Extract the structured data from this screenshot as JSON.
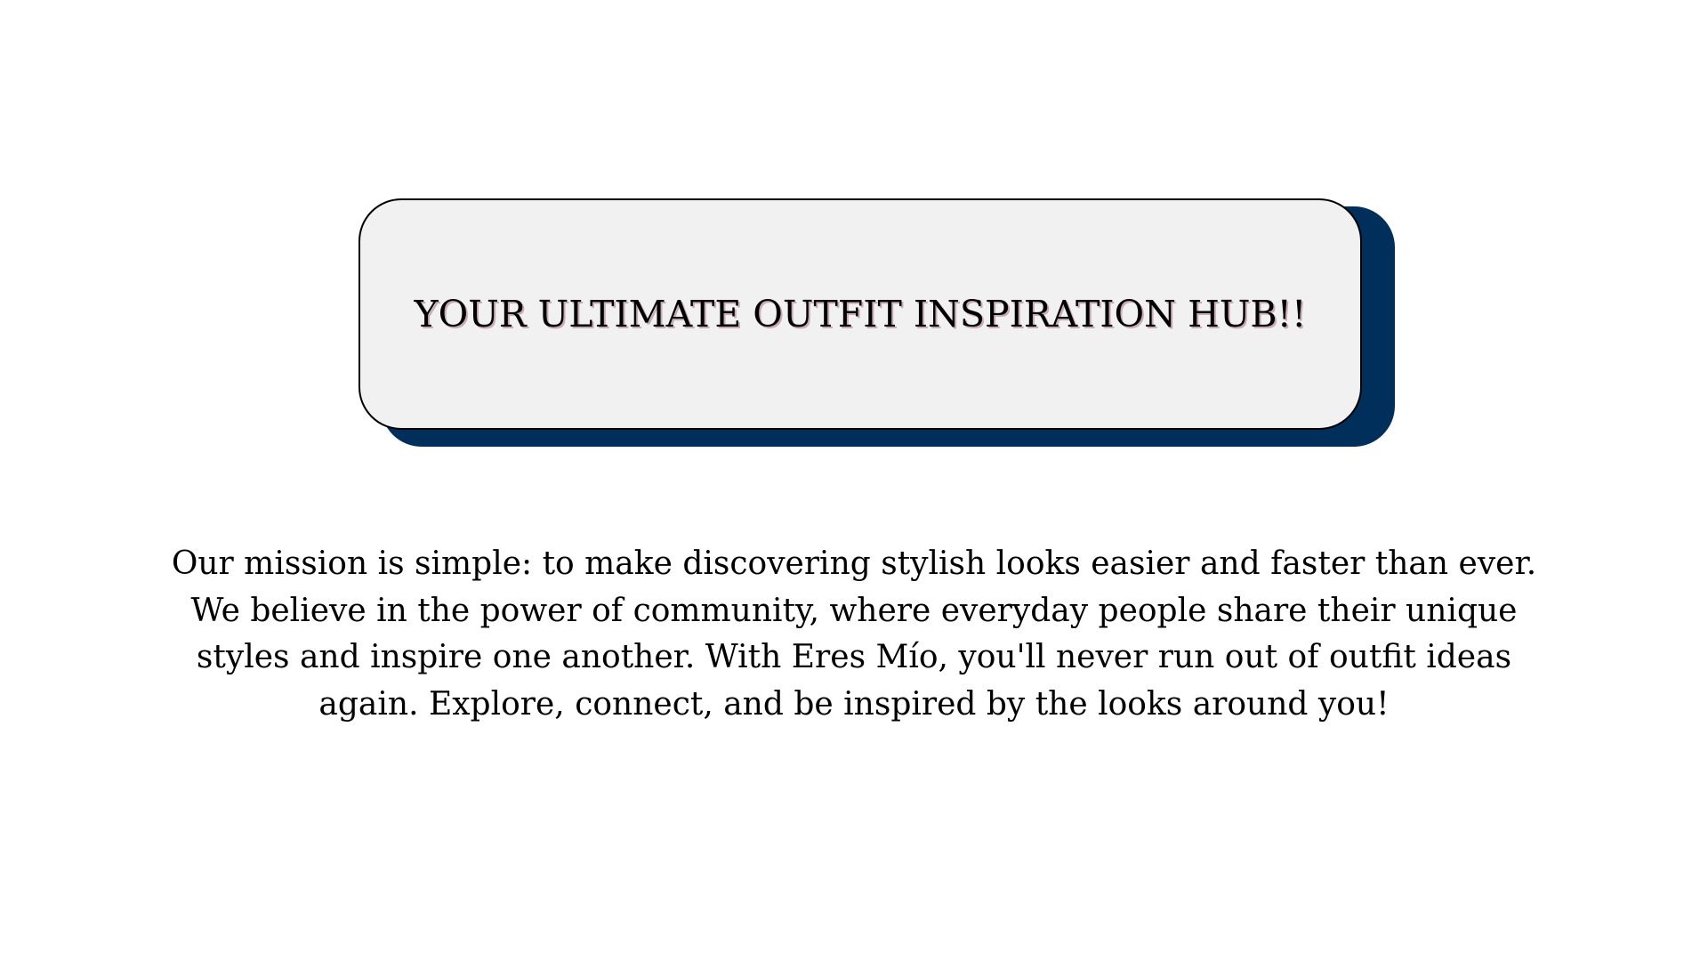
{
  "hero": {
    "title": "YOUR ULTIMATE OUTFIT INSPIRATION HUB!!"
  },
  "mission": {
    "lines": [
      "Our mission is simple: to make discovering stylish looks easier and faster than ever.",
      "We believe in the power of community, where everyday people share their unique",
      "styles and inspire one another. With Eres Mío, you'll never run out of outfit ideas",
      "again. Explore, connect, and be inspired by the looks around you!"
    ]
  },
  "colors": {
    "card_background": "#f1f1f1",
    "card_shadow": "#002f5c",
    "text": "#000000",
    "title_shadow": "#c9a9b4"
  }
}
